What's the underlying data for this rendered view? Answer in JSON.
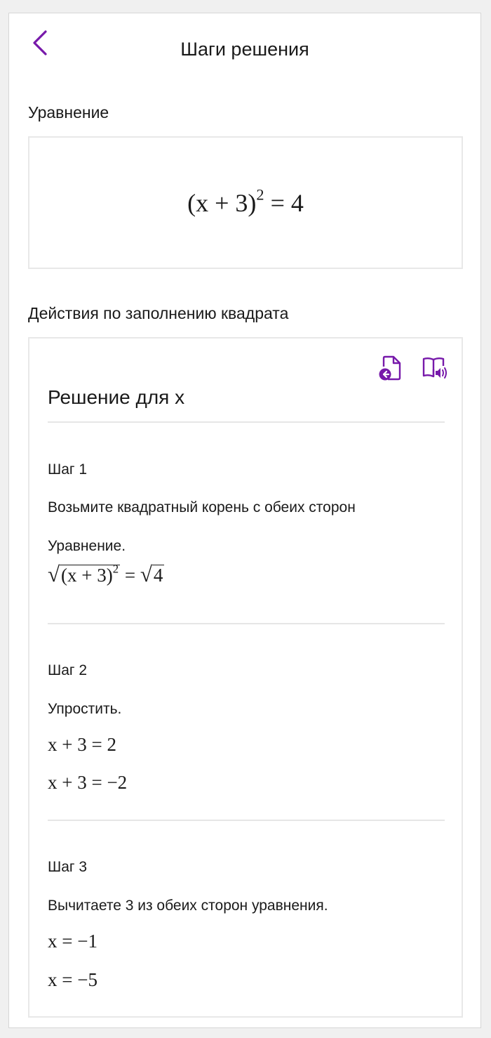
{
  "header": {
    "title": "Шаги решения"
  },
  "equation_section": {
    "label": "Уравнение",
    "equation": {
      "lhs": "(x + 3)",
      "exp": "2",
      "rhs": "= 4"
    }
  },
  "method_section": {
    "label": "Действия по заполнению квадрата"
  },
  "solution": {
    "title": "Решение для x",
    "steps": [
      {
        "label": "Шаг 1",
        "desc": "Возьмите квадратный корень с обеих сторон",
        "desc2": "Уравнение.",
        "eq": {
          "lhs": "(x + 3)",
          "exp": "2",
          "eq_sign": "=",
          "rhs": "4"
        }
      },
      {
        "label": "Шаг 2",
        "desc": "Упростить.",
        "eqs": [
          "x + 3 = 2",
          "x + 3 = −2"
        ]
      },
      {
        "label": "Шаг 3",
        "desc": "Вычитаете 3 из обеих сторон уравнения.",
        "eqs": [
          "x = −1",
          "x = −5"
        ]
      }
    ]
  },
  "icons": {
    "back": "chevron-left-icon",
    "insert": "document-insert-icon",
    "read_aloud": "immersive-reader-icon"
  },
  "colors": {
    "accent": "#7719aa",
    "divider": "#e6e6e6"
  }
}
